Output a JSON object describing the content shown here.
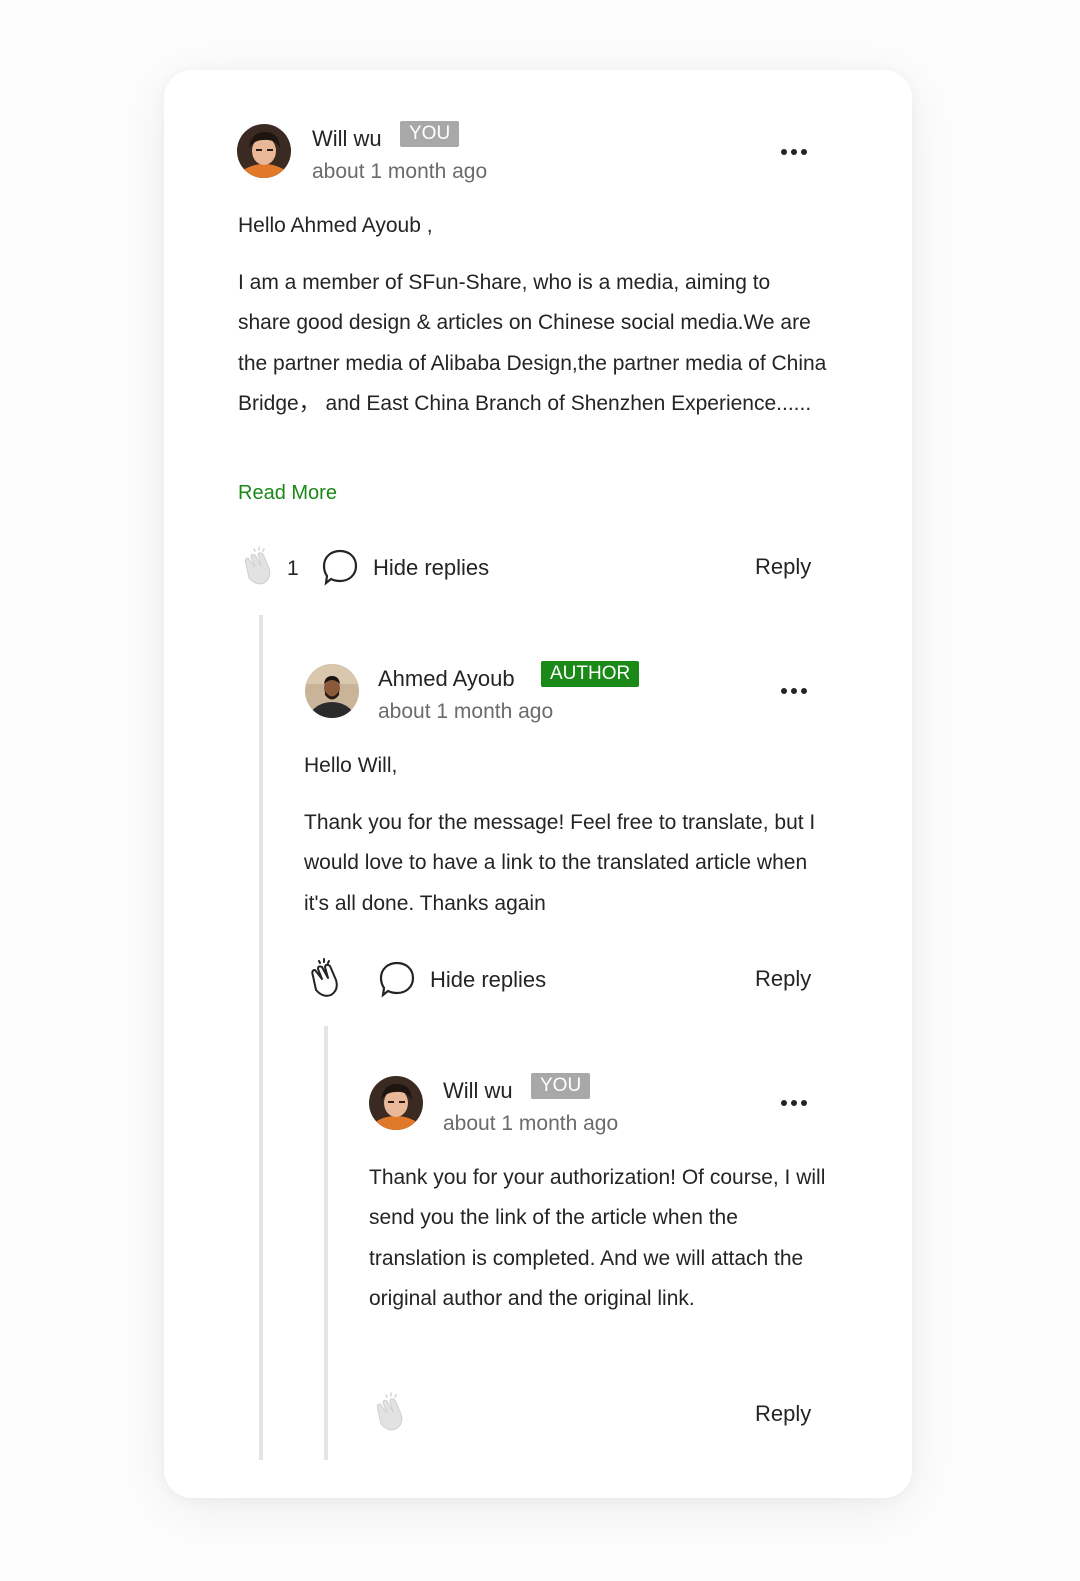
{
  "comments": [
    {
      "author": "Will wu",
      "badge": "YOU",
      "time": "about 1 month ago",
      "greeting": "Hello Ahmed Ayoub ,",
      "body": "I am a member of SFun-Share, who is a media, aiming to share good design & articles on Chinese social media.We are the partner media of Alibaba Design,the partner media of China Bridge， and East China Branch of Shenzhen Experience......",
      "read_more": "Read More",
      "clap_count": "1",
      "hide_replies": "Hide replies",
      "reply": "Reply"
    },
    {
      "author": "Ahmed Ayoub",
      "badge": "AUTHOR",
      "time": "about 1 month ago",
      "greeting": "Hello Will,",
      "body": "Thank you for the message! Feel free to translate, but I would love to have a link to the translated article when it's all done. Thanks again",
      "hide_replies": "Hide replies",
      "reply": "Reply"
    },
    {
      "author": "Will wu",
      "badge": "YOU",
      "time": "about 1 month ago",
      "body": "Thank you for your authorization! Of course, I will send you the link of the article when the translation is completed. And we will attach the original author and the original link.",
      "reply": "Reply"
    }
  ],
  "icons": {
    "clap": "clap-icon",
    "bubble": "speech-bubble-icon",
    "more": "more-icon"
  },
  "colors": {
    "accent_green": "#1a8917",
    "you_badge": "#a8a8a8",
    "thread_line": "#e4e4e4"
  }
}
